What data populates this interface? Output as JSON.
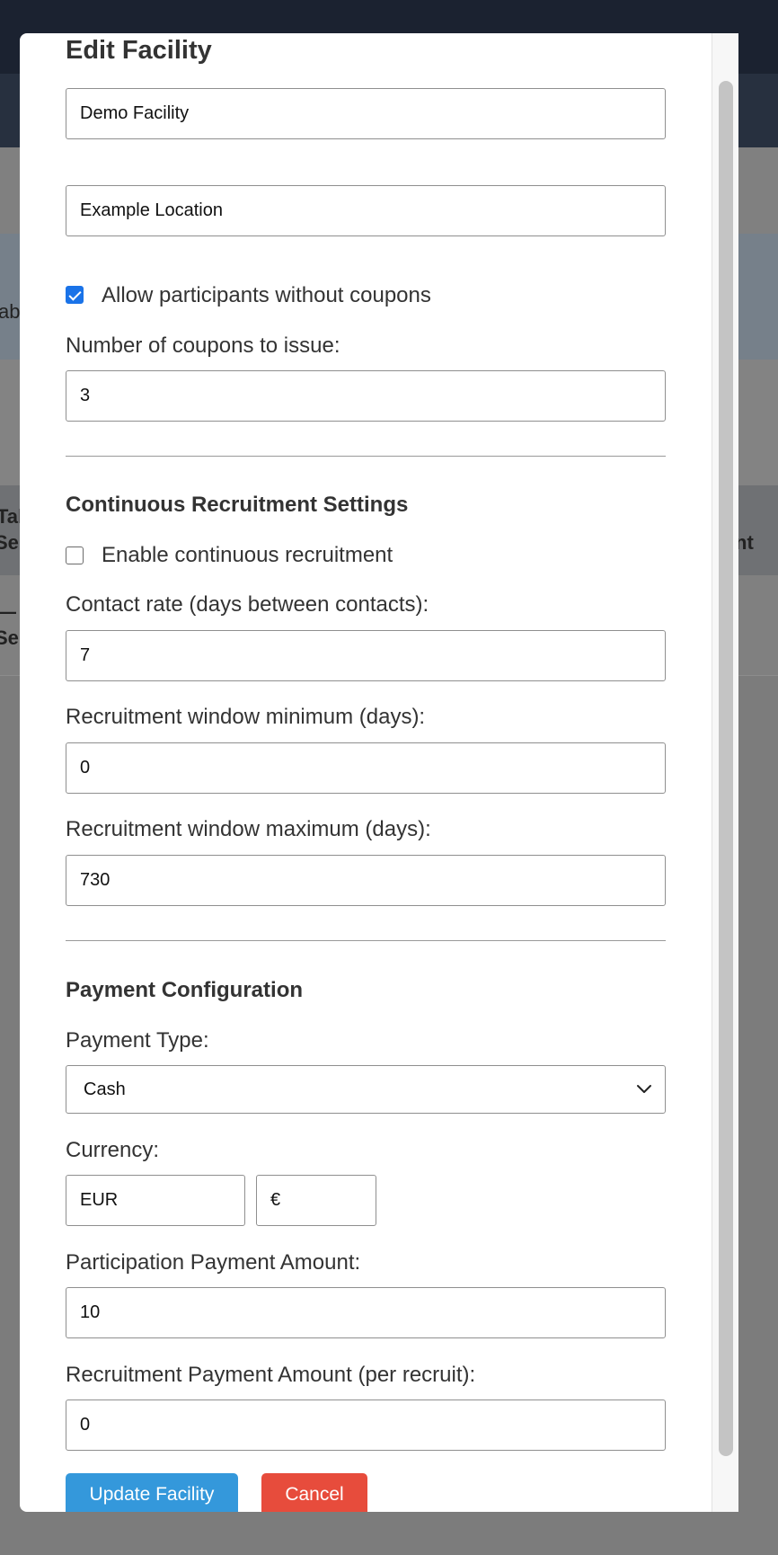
{
  "background": {
    "fragments": [
      "ab",
      "Tal",
      "Se",
      "nt",
      "— I",
      "Se"
    ]
  },
  "modal": {
    "title": "Edit Facility",
    "name_value": "Demo Facility",
    "location_value": "Example Location",
    "allow_no_coupons": {
      "label": "Allow participants without coupons",
      "checked": true
    },
    "coupons": {
      "label": "Number of coupons to issue:",
      "value": "3"
    },
    "continuous": {
      "heading": "Continuous Recruitment Settings",
      "enable": {
        "label": "Enable continuous recruitment",
        "checked": false
      },
      "contact_rate": {
        "label": "Contact rate (days between contacts):",
        "value": "7"
      },
      "window_min": {
        "label": "Recruitment window minimum (days):",
        "value": "0"
      },
      "window_max": {
        "label": "Recruitment window maximum (days):",
        "value": "730"
      }
    },
    "payment": {
      "heading": "Payment Configuration",
      "type": {
        "label": "Payment Type:",
        "value": "Cash"
      },
      "currency": {
        "label": "Currency:",
        "code": "EUR",
        "symbol": "€"
      },
      "participation": {
        "label": "Participation Payment Amount:",
        "value": "10"
      },
      "recruitment": {
        "label": "Recruitment Payment Amount (per recruit):",
        "value": "0"
      }
    },
    "buttons": {
      "update": "Update Facility",
      "cancel": "Cancel"
    }
  },
  "colors": {
    "primary": "#3498db",
    "danger": "#e74c3c",
    "checkbox_accent": "#1a73e8",
    "topbar": "#1b2230"
  }
}
